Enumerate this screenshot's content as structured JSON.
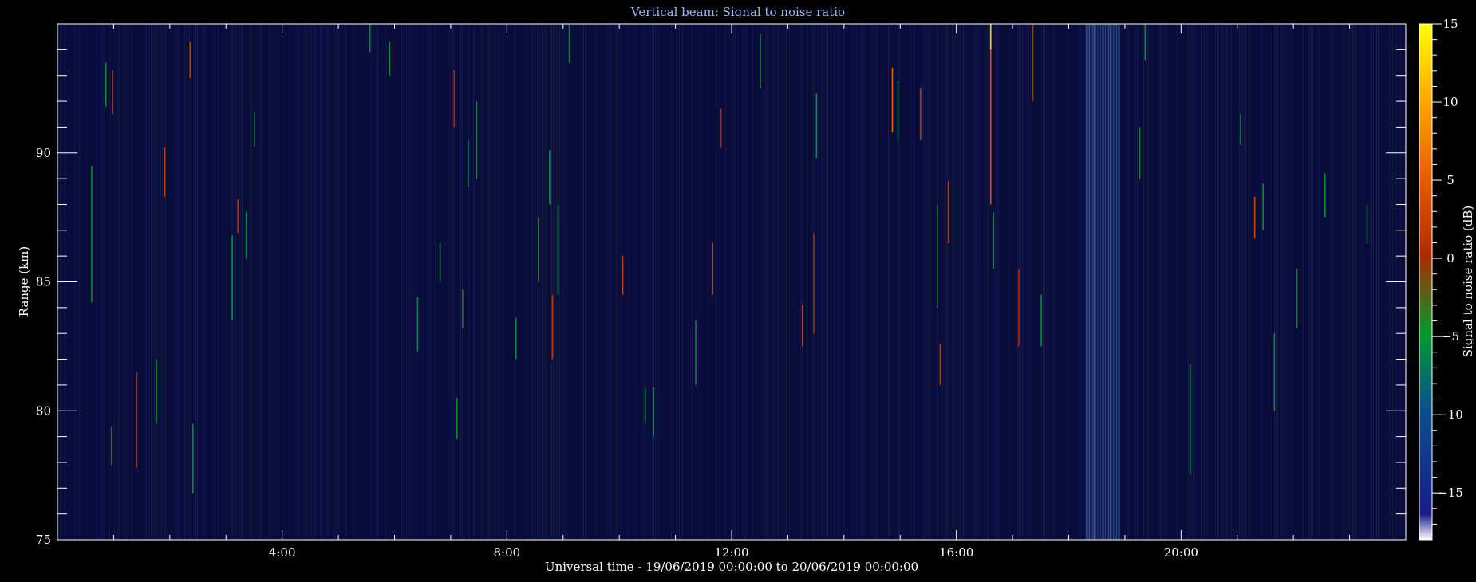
{
  "chart_data": {
    "type": "heatmap",
    "title": "Vertical beam: Signal to noise ratio",
    "xlabel": "Universal time - 19/06/2019 00:00:00 to 20/06/2019 00:00:00",
    "ylabel": "Range (km)",
    "colorbar_label": "Signal to noise ratio (dB)",
    "x_unit": "hours UT",
    "xlim": [
      0,
      24
    ],
    "ylim": [
      75,
      95
    ],
    "x_ticks": [
      {
        "value": 4,
        "label": "4:00"
      },
      {
        "value": 8,
        "label": "8:00"
      },
      {
        "value": 12,
        "label": "12:00"
      },
      {
        "value": 16,
        "label": "16:00"
      },
      {
        "value": 20,
        "label": "20:00"
      }
    ],
    "y_ticks": [
      {
        "value": 75,
        "label": "75"
      },
      {
        "value": 80,
        "label": "80"
      },
      {
        "value": 85,
        "label": "85"
      },
      {
        "value": 90,
        "label": "90"
      }
    ],
    "colorbar_range": [
      -18,
      15
    ],
    "colorbar_ticks": [
      {
        "value": 15,
        "label": "15"
      },
      {
        "value": 10,
        "label": "10"
      },
      {
        "value": 5,
        "label": "5"
      },
      {
        "value": 0,
        "label": "0"
      },
      {
        "value": -5,
        "label": "−5"
      },
      {
        "value": -10,
        "label": "−10"
      },
      {
        "value": -15,
        "label": "−15"
      }
    ],
    "background_snr_db": -17,
    "enhanced_noise_band_hours": [
      18.3,
      18.9
    ],
    "echoes": [
      {
        "t": 0.6,
        "r0": 84.2,
        "r1": 89.5,
        "snr": -4
      },
      {
        "t": 0.85,
        "r0": 91.8,
        "r1": 93.5,
        "snr": -6
      },
      {
        "t": 0.95,
        "r0": 77.9,
        "r1": 79.4,
        "snr": -2
      },
      {
        "t": 0.97,
        "r0": 91.5,
        "r1": 93.2,
        "snr": 1
      },
      {
        "t": 1.4,
        "r0": 77.8,
        "r1": 81.5,
        "snr": 0
      },
      {
        "t": 1.75,
        "r0": 79.5,
        "r1": 82.0,
        "snr": -3
      },
      {
        "t": 1.9,
        "r0": 88.3,
        "r1": 90.2,
        "snr": 1
      },
      {
        "t": 2.35,
        "r0": 92.9,
        "r1": 94.3,
        "snr": 1
      },
      {
        "t": 2.4,
        "r0": 76.8,
        "r1": 79.5,
        "snr": -5
      },
      {
        "t": 3.2,
        "r0": 86.9,
        "r1": 88.2,
        "snr": 1
      },
      {
        "t": 3.35,
        "r0": 85.9,
        "r1": 87.7,
        "snr": -5
      },
      {
        "t": 3.1,
        "r0": 83.5,
        "r1": 86.8,
        "snr": -7
      },
      {
        "t": 3.5,
        "r0": 90.2,
        "r1": 91.6,
        "snr": -6
      },
      {
        "t": 5.55,
        "r0": 93.9,
        "r1": 95.0,
        "snr": -5
      },
      {
        "t": 5.9,
        "r0": 93.0,
        "r1": 94.3,
        "snr": -6
      },
      {
        "t": 6.4,
        "r0": 82.3,
        "r1": 84.4,
        "snr": -4
      },
      {
        "t": 6.8,
        "r0": 85.0,
        "r1": 86.5,
        "snr": -5
      },
      {
        "t": 7.05,
        "r0": 91.0,
        "r1": 93.2,
        "snr": 0
      },
      {
        "t": 7.1,
        "r0": 78.9,
        "r1": 80.5,
        "snr": -5
      },
      {
        "t": 7.2,
        "r0": 83.2,
        "r1": 84.7,
        "snr": -2
      },
      {
        "t": 7.3,
        "r0": 88.7,
        "r1": 90.5,
        "snr": -6
      },
      {
        "t": 7.45,
        "r0": 89.0,
        "r1": 92.0,
        "snr": -5
      },
      {
        "t": 8.15,
        "r0": 82.0,
        "r1": 83.6,
        "snr": -6
      },
      {
        "t": 8.55,
        "r0": 85.0,
        "r1": 87.5,
        "snr": -4
      },
      {
        "t": 8.75,
        "r0": 88.0,
        "r1": 90.1,
        "snr": -6
      },
      {
        "t": 8.8,
        "r0": 82.0,
        "r1": 84.5,
        "snr": 1
      },
      {
        "t": 8.9,
        "r0": 84.5,
        "r1": 88.0,
        "snr": -5
      },
      {
        "t": 9.1,
        "r0": 93.5,
        "r1": 95.0,
        "snr": -5
      },
      {
        "t": 10.05,
        "r0": 84.5,
        "r1": 86.0,
        "snr": 2
      },
      {
        "t": 10.45,
        "r0": 79.5,
        "r1": 80.9,
        "snr": -6
      },
      {
        "t": 10.6,
        "r0": 79.0,
        "r1": 80.9,
        "snr": -6
      },
      {
        "t": 11.35,
        "r0": 81.0,
        "r1": 83.5,
        "snr": -4
      },
      {
        "t": 11.65,
        "r0": 84.5,
        "r1": 86.5,
        "snr": 2
      },
      {
        "t": 11.8,
        "r0": 90.2,
        "r1": 91.7,
        "snr": 0
      },
      {
        "t": 12.5,
        "r0": 92.5,
        "r1": 94.6,
        "snr": -5
      },
      {
        "t": 13.45,
        "r0": 83.0,
        "r1": 86.9,
        "snr": 0
      },
      {
        "t": 13.5,
        "r0": 89.8,
        "r1": 92.3,
        "snr": -7
      },
      {
        "t": 13.25,
        "r0": 82.5,
        "r1": 84.1,
        "snr": 2
      },
      {
        "t": 14.85,
        "r0": 90.8,
        "r1": 93.3,
        "snr": 4
      },
      {
        "t": 14.95,
        "r0": 90.5,
        "r1": 92.8,
        "snr": -3
      },
      {
        "t": 15.35,
        "r0": 90.5,
        "r1": 92.5,
        "snr": 1
      },
      {
        "t": 15.65,
        "r0": 84.0,
        "r1": 88.0,
        "snr": -4
      },
      {
        "t": 15.7,
        "r0": 81.0,
        "r1": 82.6,
        "snr": 1
      },
      {
        "t": 15.85,
        "r0": 86.5,
        "r1": 88.9,
        "snr": 2
      },
      {
        "t": 16.6,
        "r0": 88.0,
        "r1": 95.0,
        "snr": 3
      },
      {
        "t": 16.6,
        "r0": 94.0,
        "r1": 95.0,
        "snr": 12
      },
      {
        "t": 16.65,
        "r0": 85.5,
        "r1": 87.7,
        "snr": -4
      },
      {
        "t": 17.35,
        "r0": 92.0,
        "r1": 95.0,
        "snr": -1
      },
      {
        "t": 17.1,
        "r0": 82.5,
        "r1": 85.5,
        "snr": 0
      },
      {
        "t": 17.5,
        "r0": 82.5,
        "r1": 84.5,
        "snr": -6
      },
      {
        "t": 19.25,
        "r0": 89.0,
        "r1": 91.0,
        "snr": -6
      },
      {
        "t": 19.35,
        "r0": 93.6,
        "r1": 95.0,
        "snr": -7
      },
      {
        "t": 21.3,
        "r0": 86.7,
        "r1": 88.3,
        "snr": 2
      },
      {
        "t": 21.45,
        "r0": 87.0,
        "r1": 88.8,
        "snr": -5
      },
      {
        "t": 20.15,
        "r0": 77.5,
        "r1": 81.8,
        "snr": -5
      },
      {
        "t": 22.05,
        "r0": 83.2,
        "r1": 85.5,
        "snr": -6
      },
      {
        "t": 21.65,
        "r0": 80.0,
        "r1": 83.0,
        "snr": -5
      },
      {
        "t": 21.05,
        "r0": 90.3,
        "r1": 91.5,
        "snr": -6
      },
      {
        "t": 22.55,
        "r0": 87.5,
        "r1": 89.2,
        "snr": -6
      },
      {
        "t": 23.3,
        "r0": 86.5,
        "r1": 88.0,
        "snr": -5
      }
    ]
  }
}
